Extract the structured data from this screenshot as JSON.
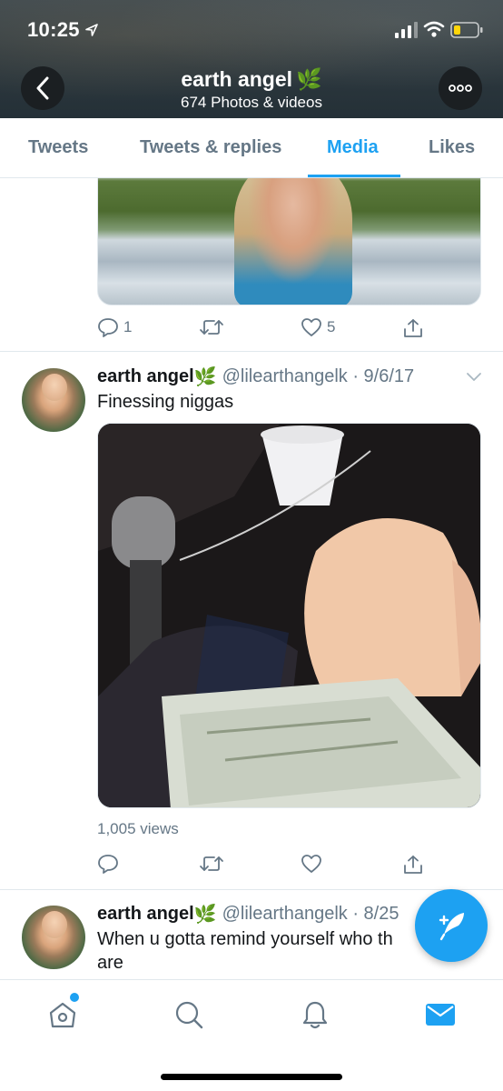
{
  "status_bar": {
    "time": "10:25"
  },
  "profile_header": {
    "name": "earth angel",
    "name_emoji": "🌿",
    "subtitle": "674 Photos & videos"
  },
  "tabs": [
    {
      "label": "Tweets",
      "active": false
    },
    {
      "label": "Tweets & replies",
      "active": false
    },
    {
      "label": "Media",
      "active": true
    },
    {
      "label": "Likes",
      "active": false
    }
  ],
  "tweets": [
    {
      "replies": "1",
      "retweets": "",
      "likes": "5"
    },
    {
      "display_name": "earth angel",
      "name_emoji": "🌿",
      "handle_date": "@lilearthangelk · 9/6/17",
      "text": "Finessing niggas",
      "views": "1,005 views",
      "replies": "",
      "retweets": "",
      "likes": ""
    },
    {
      "display_name": "earth angel",
      "name_emoji": "🌿",
      "handle_date": "@lilearthangelk · 8/25",
      "text": "When u gotta remind yourself who th are"
    }
  ],
  "bottom_nav": [
    {
      "icon": "home-icon",
      "active": false,
      "has_notification_dot": true
    },
    {
      "icon": "search-icon",
      "active": false
    },
    {
      "icon": "bell-icon",
      "active": false
    },
    {
      "icon": "mail-icon",
      "active": true
    }
  ],
  "colors": {
    "accent": "#1da1f2",
    "secondary_text": "#657786",
    "border": "#e1e8ed"
  }
}
